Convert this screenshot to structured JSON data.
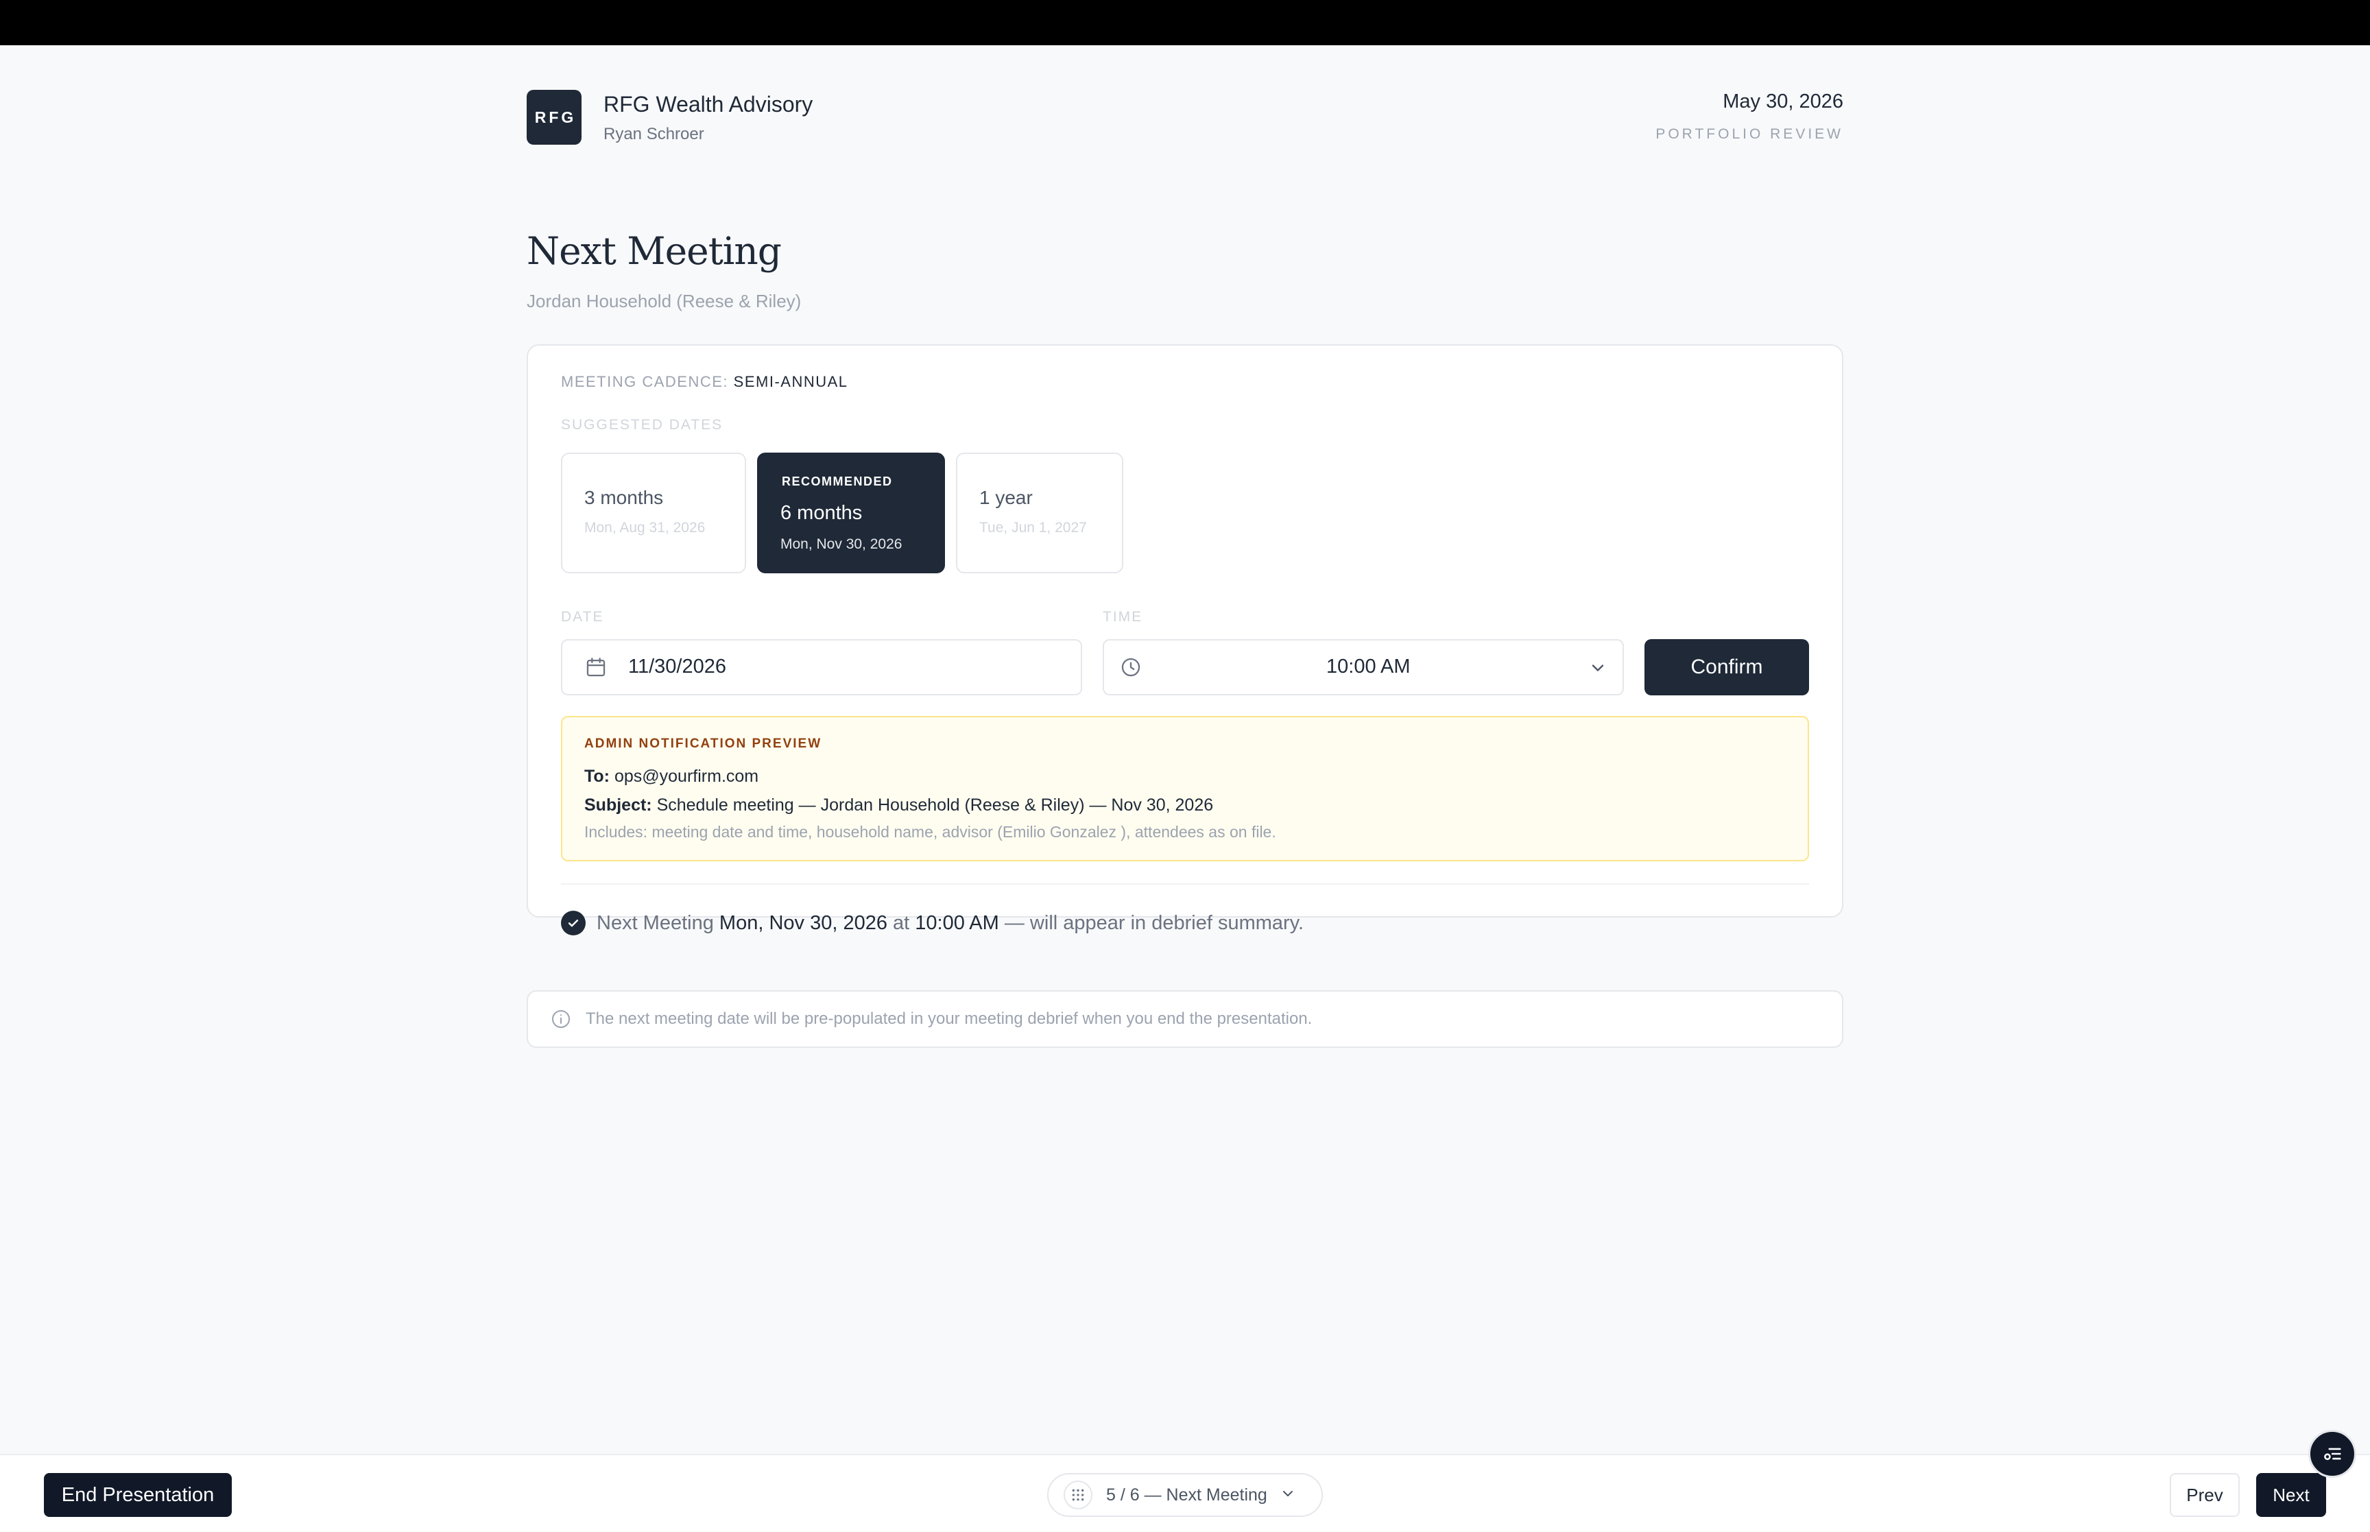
{
  "header": {
    "logo_text": "RFG",
    "firm_name": "RFG Wealth Advisory",
    "advisor_name": "Ryan Schroer",
    "date": "May 30, 2026",
    "subtitle": "PORTFOLIO REVIEW"
  },
  "page": {
    "title": "Next Meeting",
    "household": "Jordan Household (Reese & Riley)"
  },
  "cadence": {
    "label": "MEETING CADENCE:",
    "value": "SEMI-ANNUAL"
  },
  "suggested": {
    "label": "SUGGESTED DATES",
    "options": [
      {
        "label": "3 months",
        "date": "Mon, Aug 31, 2026"
      },
      {
        "tag": "RECOMMENDED",
        "label": "6 months",
        "date": "Mon, Nov 30, 2026"
      },
      {
        "label": "1 year",
        "date": "Tue, Jun 1, 2027"
      }
    ]
  },
  "form": {
    "date_label": "DATE",
    "date_value": "11/30/2026",
    "time_label": "TIME",
    "time_value": "10:00 AM",
    "confirm_label": "Confirm"
  },
  "notification": {
    "title": "ADMIN NOTIFICATION PREVIEW",
    "to_label": "To:",
    "to_value": "ops@yourfirm.com",
    "subject_label": "Subject:",
    "subject_value": "Schedule meeting — Jordan Household (Reese & Riley) — Nov 30, 2026",
    "includes": "Includes: meeting date and time, household name, advisor (Emilio Gonzalez ), attendees as on file."
  },
  "summary": {
    "prefix": "Next Meeting",
    "date": "Mon, Nov 30, 2026",
    "at": "at",
    "time": "10:00 AM",
    "suffix": "— will appear in debrief summary."
  },
  "info": {
    "text": "The next meeting date will be pre-populated in your meeting debrief when you end the presentation."
  },
  "footer": {
    "end_label": "End Presentation",
    "pager_text": "5 / 6 — Next Meeting",
    "prev_label": "Prev",
    "next_label": "Next"
  },
  "colors": {
    "primary": "#1f2937",
    "notice_bg": "#fffdf0",
    "notice_border": "#fde68a",
    "notice_title": "#92400e"
  },
  "icons": [
    "calendar-icon",
    "clock-icon",
    "chevron-down-icon",
    "check-icon",
    "info-icon",
    "grid-icon",
    "menu-icon"
  ]
}
